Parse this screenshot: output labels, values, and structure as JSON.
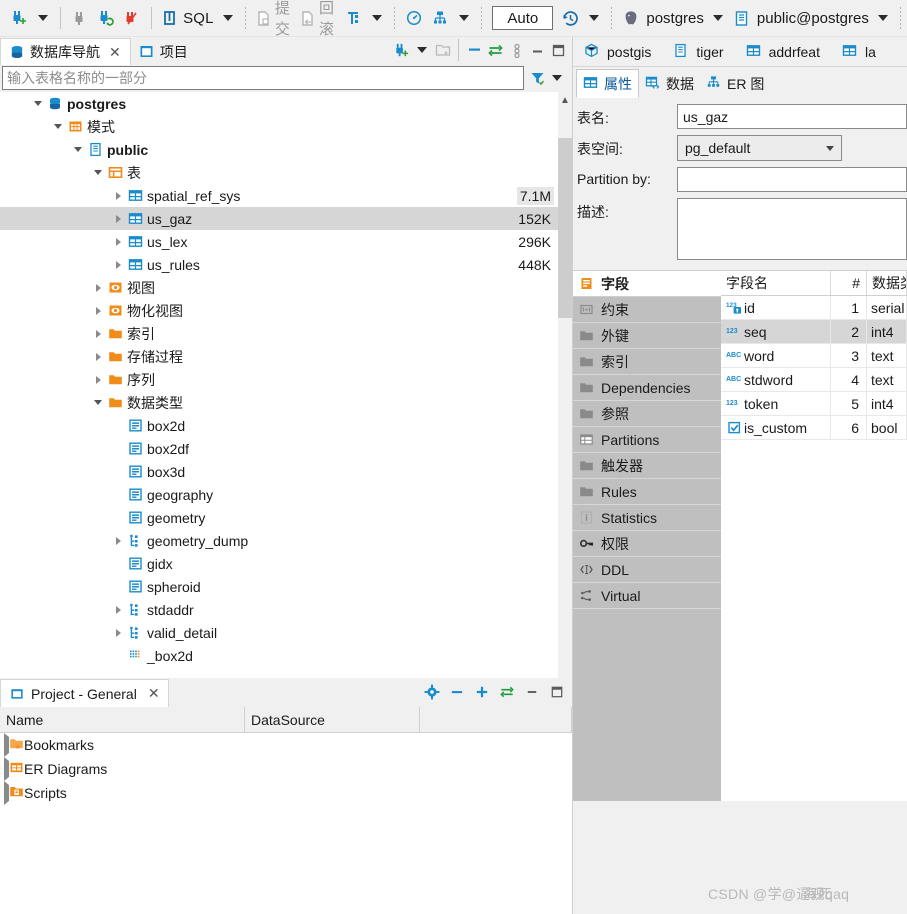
{
  "toolbar": {
    "items": [
      {
        "icon": "new-connection-icon",
        "label": ""
      },
      {
        "icon": "dropdown-caret",
        "label": ""
      },
      {
        "icon": "disconnect-icon",
        "label": ""
      },
      {
        "icon": "refresh-connection-icon",
        "label": ""
      },
      {
        "icon": "disconnect-all-icon",
        "label": ""
      },
      {
        "icon": "sql-editor-icon",
        "label": "SQL"
      },
      {
        "icon": "commit-icon",
        "label": "提交"
      },
      {
        "icon": "rollback-icon",
        "label": "回滚"
      },
      {
        "icon": "transaction-mode-icon",
        "label": ""
      },
      {
        "icon": "dashboard-icon",
        "label": ""
      },
      {
        "icon": "er-diagram-icon",
        "label": ""
      }
    ],
    "sql_label": "SQL",
    "commit_label": "提交",
    "rollback_label": "回滚",
    "auto_label": "Auto",
    "connection_label": "postgres",
    "schema_label": "public@postgres"
  },
  "navigator": {
    "tabs": [
      {
        "label": "数据库导航",
        "icon": "database-navigator-icon",
        "active": true,
        "closable": true
      },
      {
        "label": "项目",
        "icon": "project-icon",
        "active": false,
        "closable": false
      }
    ],
    "filter_placeholder": "输入表格名称的一部分",
    "tools": [
      "new-connection-icon",
      "dropdown-caret",
      "new-folder-icon",
      "collapse-all-icon",
      "link-editor-icon",
      "view-menu-icon",
      "minimize-icon",
      "maximize-icon"
    ],
    "tree": [
      {
        "indent": 1,
        "twisty": "down",
        "icon": "database-icon",
        "label": "postgres",
        "bold": true,
        "size": ""
      },
      {
        "indent": 2,
        "twisty": "down",
        "icon": "schemas-folder-icon",
        "label": "模式",
        "bold": false,
        "size": ""
      },
      {
        "indent": 3,
        "twisty": "down",
        "icon": "schema-icon",
        "label": "public",
        "bold": true,
        "size": ""
      },
      {
        "indent": 4,
        "twisty": "down",
        "icon": "tables-folder-icon",
        "label": "表",
        "bold": false,
        "size": ""
      },
      {
        "indent": 5,
        "twisty": "right",
        "icon": "table-icon",
        "label": "spatial_ref_sys",
        "bold": false,
        "size": "7.1M",
        "size_highlight": true
      },
      {
        "indent": 5,
        "twisty": "right",
        "icon": "table-icon",
        "label": "us_gaz",
        "bold": false,
        "size": "152K",
        "selected": true
      },
      {
        "indent": 5,
        "twisty": "right",
        "icon": "table-icon",
        "label": "us_lex",
        "bold": false,
        "size": "296K"
      },
      {
        "indent": 5,
        "twisty": "right",
        "icon": "table-icon",
        "label": "us_rules",
        "bold": false,
        "size": "448K"
      },
      {
        "indent": 4,
        "twisty": "right",
        "icon": "view-icon",
        "label": "视图",
        "bold": false,
        "size": ""
      },
      {
        "indent": 4,
        "twisty": "right",
        "icon": "view-icon",
        "label": "物化视图",
        "bold": false,
        "size": ""
      },
      {
        "indent": 4,
        "twisty": "right",
        "icon": "folder-icon",
        "label": "索引",
        "bold": false,
        "size": ""
      },
      {
        "indent": 4,
        "twisty": "right",
        "icon": "folder-icon",
        "label": "存储过程",
        "bold": false,
        "size": ""
      },
      {
        "indent": 4,
        "twisty": "right",
        "icon": "folder-icon",
        "label": "序列",
        "bold": false,
        "size": ""
      },
      {
        "indent": 4,
        "twisty": "down",
        "icon": "folder-icon",
        "label": "数据类型",
        "bold": false,
        "size": ""
      },
      {
        "indent": 5,
        "twisty": "none",
        "icon": "datatype-icon",
        "label": "box2d",
        "bold": false,
        "size": ""
      },
      {
        "indent": 5,
        "twisty": "none",
        "icon": "datatype-icon",
        "label": "box2df",
        "bold": false,
        "size": ""
      },
      {
        "indent": 5,
        "twisty": "none",
        "icon": "datatype-icon",
        "label": "box3d",
        "bold": false,
        "size": ""
      },
      {
        "indent": 5,
        "twisty": "none",
        "icon": "datatype-icon",
        "label": "geography",
        "bold": false,
        "size": ""
      },
      {
        "indent": 5,
        "twisty": "none",
        "icon": "datatype-icon",
        "label": "geometry",
        "bold": false,
        "size": ""
      },
      {
        "indent": 5,
        "twisty": "right",
        "icon": "composite-type-icon",
        "label": "geometry_dump",
        "bold": false,
        "size": ""
      },
      {
        "indent": 5,
        "twisty": "none",
        "icon": "datatype-icon",
        "label": "gidx",
        "bold": false,
        "size": ""
      },
      {
        "indent": 5,
        "twisty": "none",
        "icon": "datatype-icon",
        "label": "spheroid",
        "bold": false,
        "size": ""
      },
      {
        "indent": 5,
        "twisty": "right",
        "icon": "composite-type-icon",
        "label": "stdaddr",
        "bold": false,
        "size": ""
      },
      {
        "indent": 5,
        "twisty": "right",
        "icon": "composite-type-icon",
        "label": "valid_detail",
        "bold": false,
        "size": ""
      },
      {
        "indent": 5,
        "twisty": "none",
        "icon": "array-type-icon",
        "label": "_box2d",
        "bold": false,
        "size": ""
      }
    ]
  },
  "project": {
    "tab_label": "Project - General",
    "tab_icon": "project-icon",
    "tools": [
      "gear-icon",
      "minimize-icon",
      "maximize-icon",
      "link-editor-icon",
      "restore-icon",
      "maximize-panel-icon"
    ],
    "columns": [
      "Name",
      "DataSource"
    ],
    "rows": [
      {
        "icon": "bookmarks-folder-icon",
        "name": "Bookmarks",
        "datasource": ""
      },
      {
        "icon": "er-diagrams-folder-icon",
        "name": "ER Diagrams",
        "datasource": ""
      },
      {
        "icon": "scripts-folder-icon",
        "name": "Scripts",
        "datasource": ""
      }
    ]
  },
  "editor": {
    "tabs": [
      {
        "label": "postgis",
        "icon": "extension-icon",
        "active": false
      },
      {
        "label": "tiger",
        "icon": "schema-icon",
        "active": false
      },
      {
        "label": "addrfeat",
        "icon": "table-icon",
        "active": false
      },
      {
        "label": "la",
        "icon": "table-icon",
        "active": false
      }
    ],
    "subtabs": [
      {
        "label": "属性",
        "icon": "properties-icon",
        "active": true
      },
      {
        "label": "数据",
        "icon": "data-icon",
        "active": false
      },
      {
        "label": "ER 图",
        "icon": "er-diagram-icon",
        "active": false
      }
    ],
    "form": {
      "table_name_label": "表名:",
      "table_name_value": "us_gaz",
      "tablespace_label": "表空间:",
      "tablespace_value": "pg_default",
      "partition_by_label": "Partition by:",
      "partition_by_value": "",
      "description_label": "描述:",
      "description_value": ""
    },
    "prop_nav": [
      {
        "label": "字段",
        "icon": "columns-icon",
        "active": true
      },
      {
        "label": "约束",
        "icon": "constraint-icon",
        "active": false
      },
      {
        "label": "外键",
        "icon": "folder-icon",
        "active": false
      },
      {
        "label": "索引",
        "icon": "folder-icon",
        "active": false
      },
      {
        "label": "Dependencies",
        "icon": "folder-icon",
        "active": false
      },
      {
        "label": "参照",
        "icon": "folder-icon",
        "active": false
      },
      {
        "label": "Partitions",
        "icon": "partitions-icon",
        "active": false
      },
      {
        "label": "触发器",
        "icon": "folder-icon",
        "active": false
      },
      {
        "label": "Rules",
        "icon": "folder-icon",
        "active": false
      },
      {
        "label": "Statistics",
        "icon": "info-icon",
        "active": false
      },
      {
        "label": "权限",
        "icon": "key-icon",
        "active": false
      },
      {
        "label": "DDL",
        "icon": "ddl-icon",
        "active": false
      },
      {
        "label": "Virtual",
        "icon": "virtual-icon",
        "active": false
      }
    ],
    "grid": {
      "columns": [
        "字段名",
        "#",
        "数据类型"
      ],
      "rows": [
        {
          "type_icon": "serial-key-icon",
          "name": "id",
          "num": "1",
          "datatype": "serial"
        },
        {
          "type_icon": "number-icon",
          "name": "seq",
          "num": "2",
          "datatype": "int4",
          "selected": true
        },
        {
          "type_icon": "text-icon",
          "name": "word",
          "num": "3",
          "datatype": "text"
        },
        {
          "type_icon": "text-icon",
          "name": "stdword",
          "num": "4",
          "datatype": "text"
        },
        {
          "type_icon": "number-icon",
          "name": "token",
          "num": "5",
          "datatype": "int4"
        },
        {
          "type_icon": "boolean-icon",
          "name": "is_custom",
          "num": "6",
          "datatype": "bool"
        }
      ]
    }
  },
  "watermark": {
    "text_a": "CSDN @学@逼观qaq",
    "text_b": "海死"
  },
  "colors": {
    "accent_blue": "#1a8ccc",
    "orange": "#f08c1a",
    "green": "#2ea02e",
    "red": "#e03b2b",
    "selection_gray": "#d6d6d6"
  }
}
